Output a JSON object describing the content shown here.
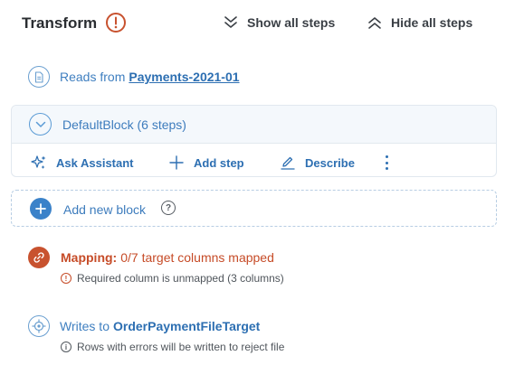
{
  "header": {
    "title": "Transform",
    "show_all_label": "Show all steps",
    "hide_all_label": "Hide all steps"
  },
  "source": {
    "prefix": "Reads from",
    "dataset": "Payments-2021-01"
  },
  "block": {
    "name": "DefaultBlock (6 steps)",
    "actions": {
      "assistant": "Ask Assistant",
      "add_step": "Add step",
      "describe": "Describe"
    }
  },
  "add_block": {
    "label": "Add new block",
    "help_glyph": "?"
  },
  "mapping": {
    "label": "Mapping:",
    "status": "0/7 target columns mapped",
    "warning": "Required column is unmapped (3 columns)",
    "warning_glyph": "!"
  },
  "target": {
    "prefix": "Writes to",
    "name": "OrderPaymentFileTarget",
    "info": "Rows with errors will be written to reject file",
    "info_glyph": "i"
  },
  "colors": {
    "accent": "#3b82c9",
    "link": "#2d6fb2",
    "error": "#c64b27",
    "text": "#2a2d31"
  },
  "icons": [
    "warning-circle-icon",
    "double-chevron-down-icon",
    "double-chevron-up-icon",
    "document-icon",
    "chevron-down-icon",
    "sparkles-icon",
    "plus-icon",
    "pencil-icon",
    "kebab-icon",
    "plus-circle-icon",
    "help-icon",
    "link-icon",
    "target-icon"
  ]
}
